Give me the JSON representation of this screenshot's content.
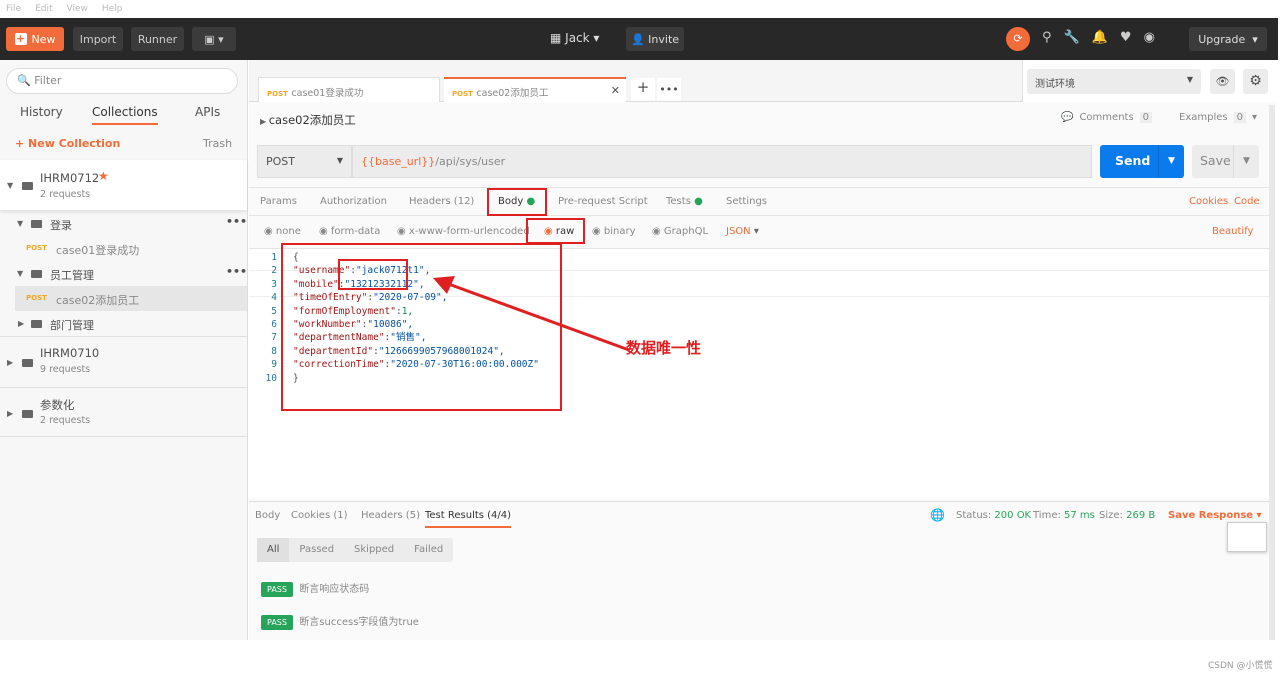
{
  "menubar": [
    "File",
    "Edit",
    "View",
    "Help"
  ],
  "topbar": {
    "new": "New",
    "import": "Import",
    "runner": "Runner",
    "workspace": "Jack",
    "invite": "Invite",
    "upgrade": "Upgrade"
  },
  "sidebar": {
    "filter_placeholder": "Filter",
    "tabs": [
      "History",
      "Collections",
      "APIs"
    ],
    "new_collection": "+ New Collection",
    "trash": "Trash",
    "collections": [
      {
        "name": "IHRM0712",
        "count": "2 requests"
      },
      {
        "name": "IHRM0710",
        "count": "9 requests"
      },
      {
        "name": "参数化",
        "count": "2 requests"
      }
    ],
    "folders": [
      "登录",
      "员工管理",
      "部门管理"
    ],
    "requests": [
      {
        "method": "POST",
        "name": "case01登录成功"
      },
      {
        "method": "POST",
        "name": "case02添加员工"
      }
    ]
  },
  "tabs": [
    {
      "method": "POST",
      "name": "case01登录成功"
    },
    {
      "method": "POST",
      "name": "case02添加员工"
    }
  ],
  "environment": "测试环境",
  "request": {
    "title": "case02添加员工",
    "comments": "Comments",
    "comments_count": "0",
    "examples": "Examples",
    "examples_count": "0",
    "method": "POST",
    "url_var": "{{base_url}}",
    "url_path": "/api/sys/user",
    "send": "Send",
    "save": "Save"
  },
  "req_tabs": [
    "Params",
    "Authorization",
    "Headers (12)",
    "Body",
    "Pre-request Script",
    "Tests",
    "Settings"
  ],
  "cookies": "Cookies",
  "code": "Code",
  "body_types": [
    "none",
    "form-data",
    "x-www-form-urlencoded",
    "raw",
    "binary",
    "GraphQL"
  ],
  "format": "JSON",
  "beautify": "Beautify",
  "code_lines": [
    {
      "k": "{",
      "v": ""
    },
    {
      "k": "\"username\"",
      "v": "\"jack0712t1\","
    },
    {
      "k": "\"mobile\"",
      "v": "\"13212332112\","
    },
    {
      "k": "\"timeOfEntry\"",
      "v": "\"2020-07-09\","
    },
    {
      "k": "\"formOfEmployment\"",
      "v": "1,"
    },
    {
      "k": "\"workNumber\"",
      "v": "\"10086\","
    },
    {
      "k": "\"departmentName\"",
      "v": "\"销售\","
    },
    {
      "k": "\"departmentId\"",
      "v": "\"1266699057968001024\","
    },
    {
      "k": "\"correctionTime\"",
      "v": "\"2020-07-30T16:00:00.000Z\""
    },
    {
      "k": "}",
      "v": ""
    }
  ],
  "annotation": "数据唯一性",
  "response": {
    "tabs": [
      "Body",
      "Cookies (1)",
      "Headers (5)",
      "Test Results (4/4)"
    ],
    "status_label": "Status:",
    "status": "200 OK",
    "time_label": "Time:",
    "time": "57 ms",
    "size_label": "Size:",
    "size": "269 B",
    "save_response": "Save Response",
    "filters": [
      "All",
      "Passed",
      "Skipped",
      "Failed"
    ],
    "results": [
      {
        "badge": "PASS",
        "text": "断言响应状态码"
      },
      {
        "badge": "PASS",
        "text": "断言success字段值为true"
      }
    ]
  },
  "watermark": "CSDN @小慌慌"
}
